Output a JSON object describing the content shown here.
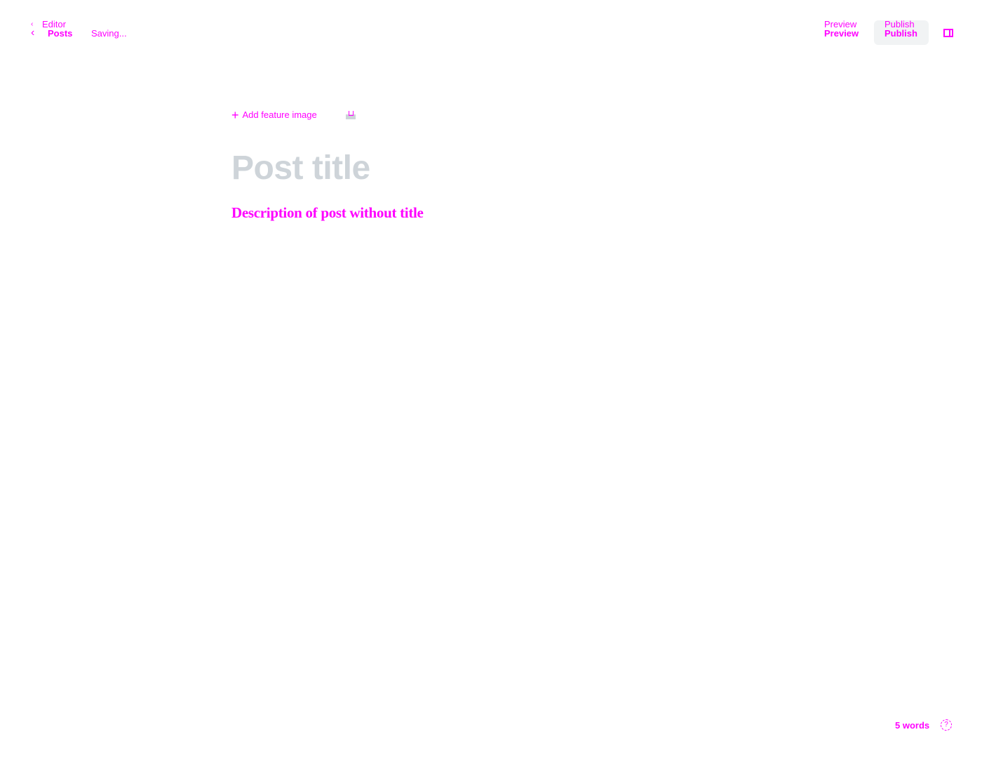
{
  "header": {
    "back_label_top": "Editor",
    "back_label": "Posts",
    "status": "Saving...",
    "preview_top": "Preview",
    "preview": "Preview",
    "publish_top": "Publish",
    "publish": "Publish",
    "sidebar_toggle_icon": "sidebar-panel-icon"
  },
  "editor": {
    "add_feature_image": "Add feature image",
    "title_placeholder": "Post title",
    "body_text": "Description of post without title"
  },
  "footer": {
    "word_count": "5 words",
    "help_icon": "help-circle-icon"
  },
  "colors": {
    "text": "#ff00ff",
    "placeholder": "#ced4d9",
    "button_bg": "#f1f3f4"
  }
}
